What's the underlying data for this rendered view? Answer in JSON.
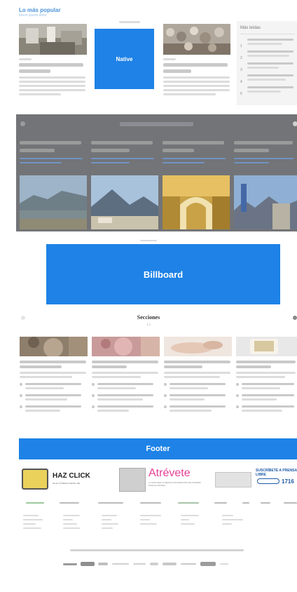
{
  "popular": {
    "title": "Lo más popular",
    "subtitle": "lorem ipsum dolor"
  },
  "native_label": "Native",
  "most_read": {
    "title": "Más leídas",
    "ranks": [
      "1",
      "2",
      "3",
      "4",
      "5"
    ]
  },
  "carousel": {
    "heading": "",
    "accent": "#737477"
  },
  "billboard_label": "Billboard",
  "sections": {
    "title": "Secciones",
    "page": "1 2"
  },
  "footer_label": "Footer",
  "promos": [
    {
      "main": "HAZ CLICK",
      "sub": "EN EL NÚMERO PERFIL.ME"
    },
    {
      "main": "Atrévete",
      "sub": "A CONOCER LA MEJOR INFORMACIÓN DE INTERÉS PARA EL MUNDO"
    },
    {
      "main": "SUSCRÍBETE A PRENSA LIBRE",
      "sub": "1716"
    }
  ],
  "colors": {
    "blue": "#1e82e6",
    "carousel_bg": "#737477",
    "pink": "#e43f96",
    "accent": "#4a93d9"
  }
}
